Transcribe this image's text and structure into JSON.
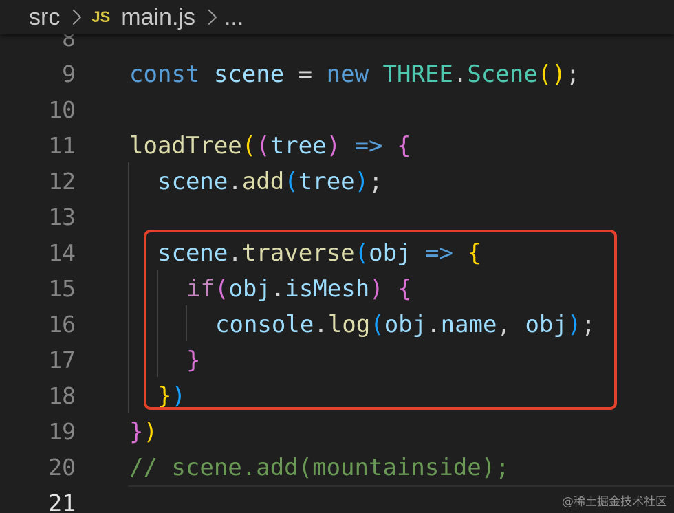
{
  "breadcrumb": {
    "folder": "src",
    "file_icon": "JS",
    "file": "main.js",
    "ellipsis": "..."
  },
  "line_numbers": [
    "8",
    "9",
    "10",
    "11",
    "12",
    "13",
    "14",
    "15",
    "16",
    "17",
    "18",
    "19",
    "20",
    "21"
  ],
  "code": {
    "l9": {
      "t1": "const",
      "t2": "scene",
      "t3": " = ",
      "t4": "new",
      "t5": "THREE",
      "t6": ".",
      "t7": "Scene",
      "t8": "()",
      "t9": ";"
    },
    "l11": {
      "t1": "loadTree",
      "t2": "(",
      "t3": "(",
      "t4": "tree",
      "t5": ")",
      "t6": " => ",
      "t7": "{"
    },
    "l12": {
      "t1": "scene",
      "t2": ".",
      "t3": "add",
      "t4": "(",
      "t5": "tree",
      "t6": ")",
      "t7": ";"
    },
    "l14": {
      "t1": "scene",
      "t2": ".",
      "t3": "traverse",
      "t4": "(",
      "t5": "obj",
      "t6": " => ",
      "t7": "{"
    },
    "l15": {
      "t1": "if",
      "t2": "(",
      "t3": "obj",
      "t4": ".",
      "t5": "isMesh",
      "t6": ")",
      "t7": " {"
    },
    "l16": {
      "t1": "console",
      "t2": ".",
      "t3": "log",
      "t4": "(",
      "t5": "obj",
      "t6": ".",
      "t7": "name",
      "t8": ", ",
      "t9": "obj",
      "t10": ")",
      "t11": ";"
    },
    "l17": {
      "t1": "}"
    },
    "l18": {
      "t1": "}",
      "t2": ")"
    },
    "l19": {
      "t1": "}",
      "t2": ")"
    },
    "l20": {
      "t1": "// scene.add(mountainside);"
    }
  },
  "watermark": "@稀土掘金技术社区",
  "colors": {
    "background": "#1f1f1f",
    "highlight_box": "#e3412b",
    "keyword": "#569cd6",
    "control_keyword": "#c586c0",
    "variable": "#9cdcfe",
    "function": "#dcdcaa",
    "class": "#4ec9b0",
    "comment": "#6a9955",
    "bracket_level1": "#ffd700",
    "bracket_level2": "#da70d6",
    "bracket_level3": "#179fff"
  }
}
